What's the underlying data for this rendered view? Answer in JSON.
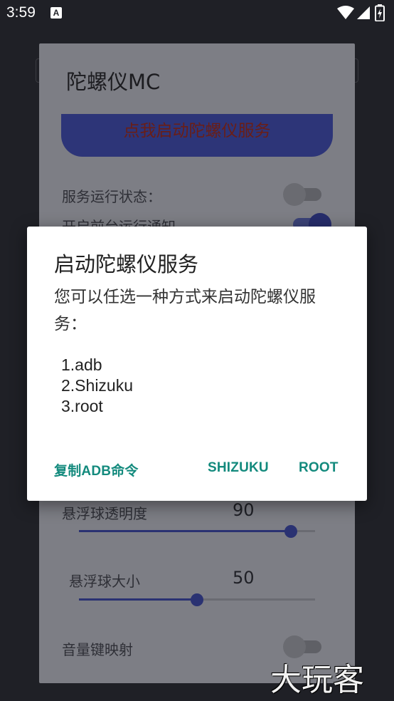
{
  "status_bar": {
    "time": "3:59",
    "notification_icon": "A"
  },
  "background_app": {
    "title": "陀螺仪MC",
    "start_service_button": "点我启动陀螺仪服务",
    "service_status_label": "服务运行状态：",
    "foreground_notification_label": "开启前台运行通知",
    "float_opacity_label": "悬浮球透明度",
    "float_opacity_value": "90",
    "float_size_label": "悬浮球大小",
    "float_size_value": "50",
    "volume_key_mapping_label": "音量键映射"
  },
  "dialog": {
    "title": "启动陀螺仪服务",
    "message": "您可以任选一种方式来启动陀螺仪服务：",
    "options": [
      "1.adb",
      "2.Shizuku",
      "3.root"
    ],
    "buttons": {
      "copy_adb": "复制ADB命令",
      "shizuku": "SHIZUKU",
      "root": "ROOT"
    }
  },
  "watermark": "大玩客",
  "colors": {
    "accent": "#138a7d",
    "primary": "#2d3578"
  }
}
